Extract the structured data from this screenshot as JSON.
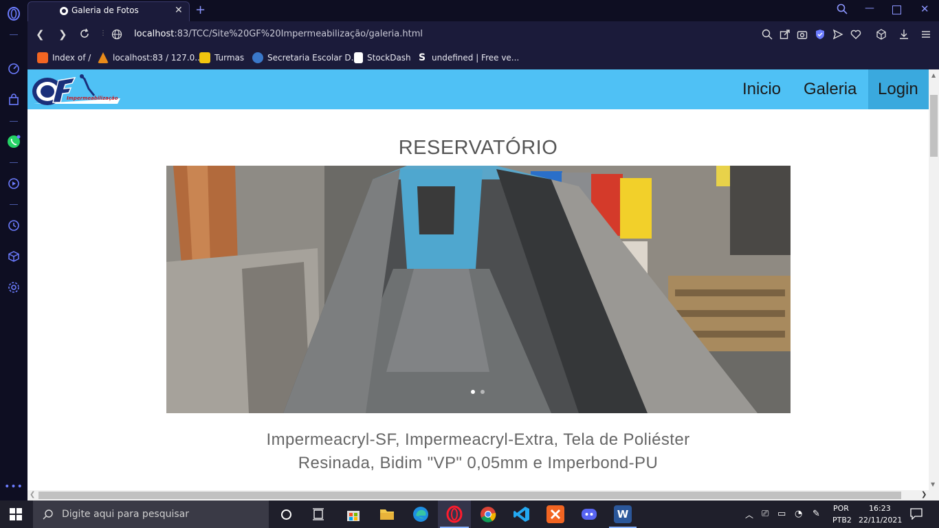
{
  "browser": {
    "tab": {
      "title": "Galeria de Fotos"
    },
    "address": {
      "host": "localhost",
      "path": ":83/TCC/Site%20GF%20Impermeabilização/galeria.html"
    },
    "bookmarks": [
      {
        "label": "Index of /",
        "color": "#f26522"
      },
      {
        "label": "localhost:83 / 127.0...",
        "color": "#e88a1a"
      },
      {
        "label": "Turmas",
        "color": "#f1c40f"
      },
      {
        "label": "Secretaria Escolar D...",
        "color": "#3a78c9"
      },
      {
        "label": "StockDash",
        "color": "#ffffff"
      },
      {
        "label": "undefined | Free ve...",
        "color": "#1b1b3a"
      }
    ]
  },
  "site": {
    "logo": {
      "letters": "GF",
      "text": "Impermeabilização"
    },
    "nav": {
      "inicio": "Inicio",
      "galeria": "Galeria",
      "login": "Login"
    },
    "gallery": {
      "title": "RESERVATÓRIO",
      "caption_line1": "Impermeacryl-SF, Impermeacryl-Extra, Tela de Poliéster",
      "caption_line2": "Resinada, Bidim \"VP\" 0,05mm e Imperbond-PU",
      "slide_count": 2,
      "active_slide": 1
    }
  },
  "taskbar": {
    "search_placeholder": "Digite aqui para pesquisar",
    "lang1": "POR",
    "lang2": "PTB2",
    "time": "16:23",
    "date": "22/11/2021"
  },
  "colors": {
    "navbar": "#4fc1f5",
    "login_active": "#3aa9de",
    "opera_red": "#ff1b2d"
  }
}
